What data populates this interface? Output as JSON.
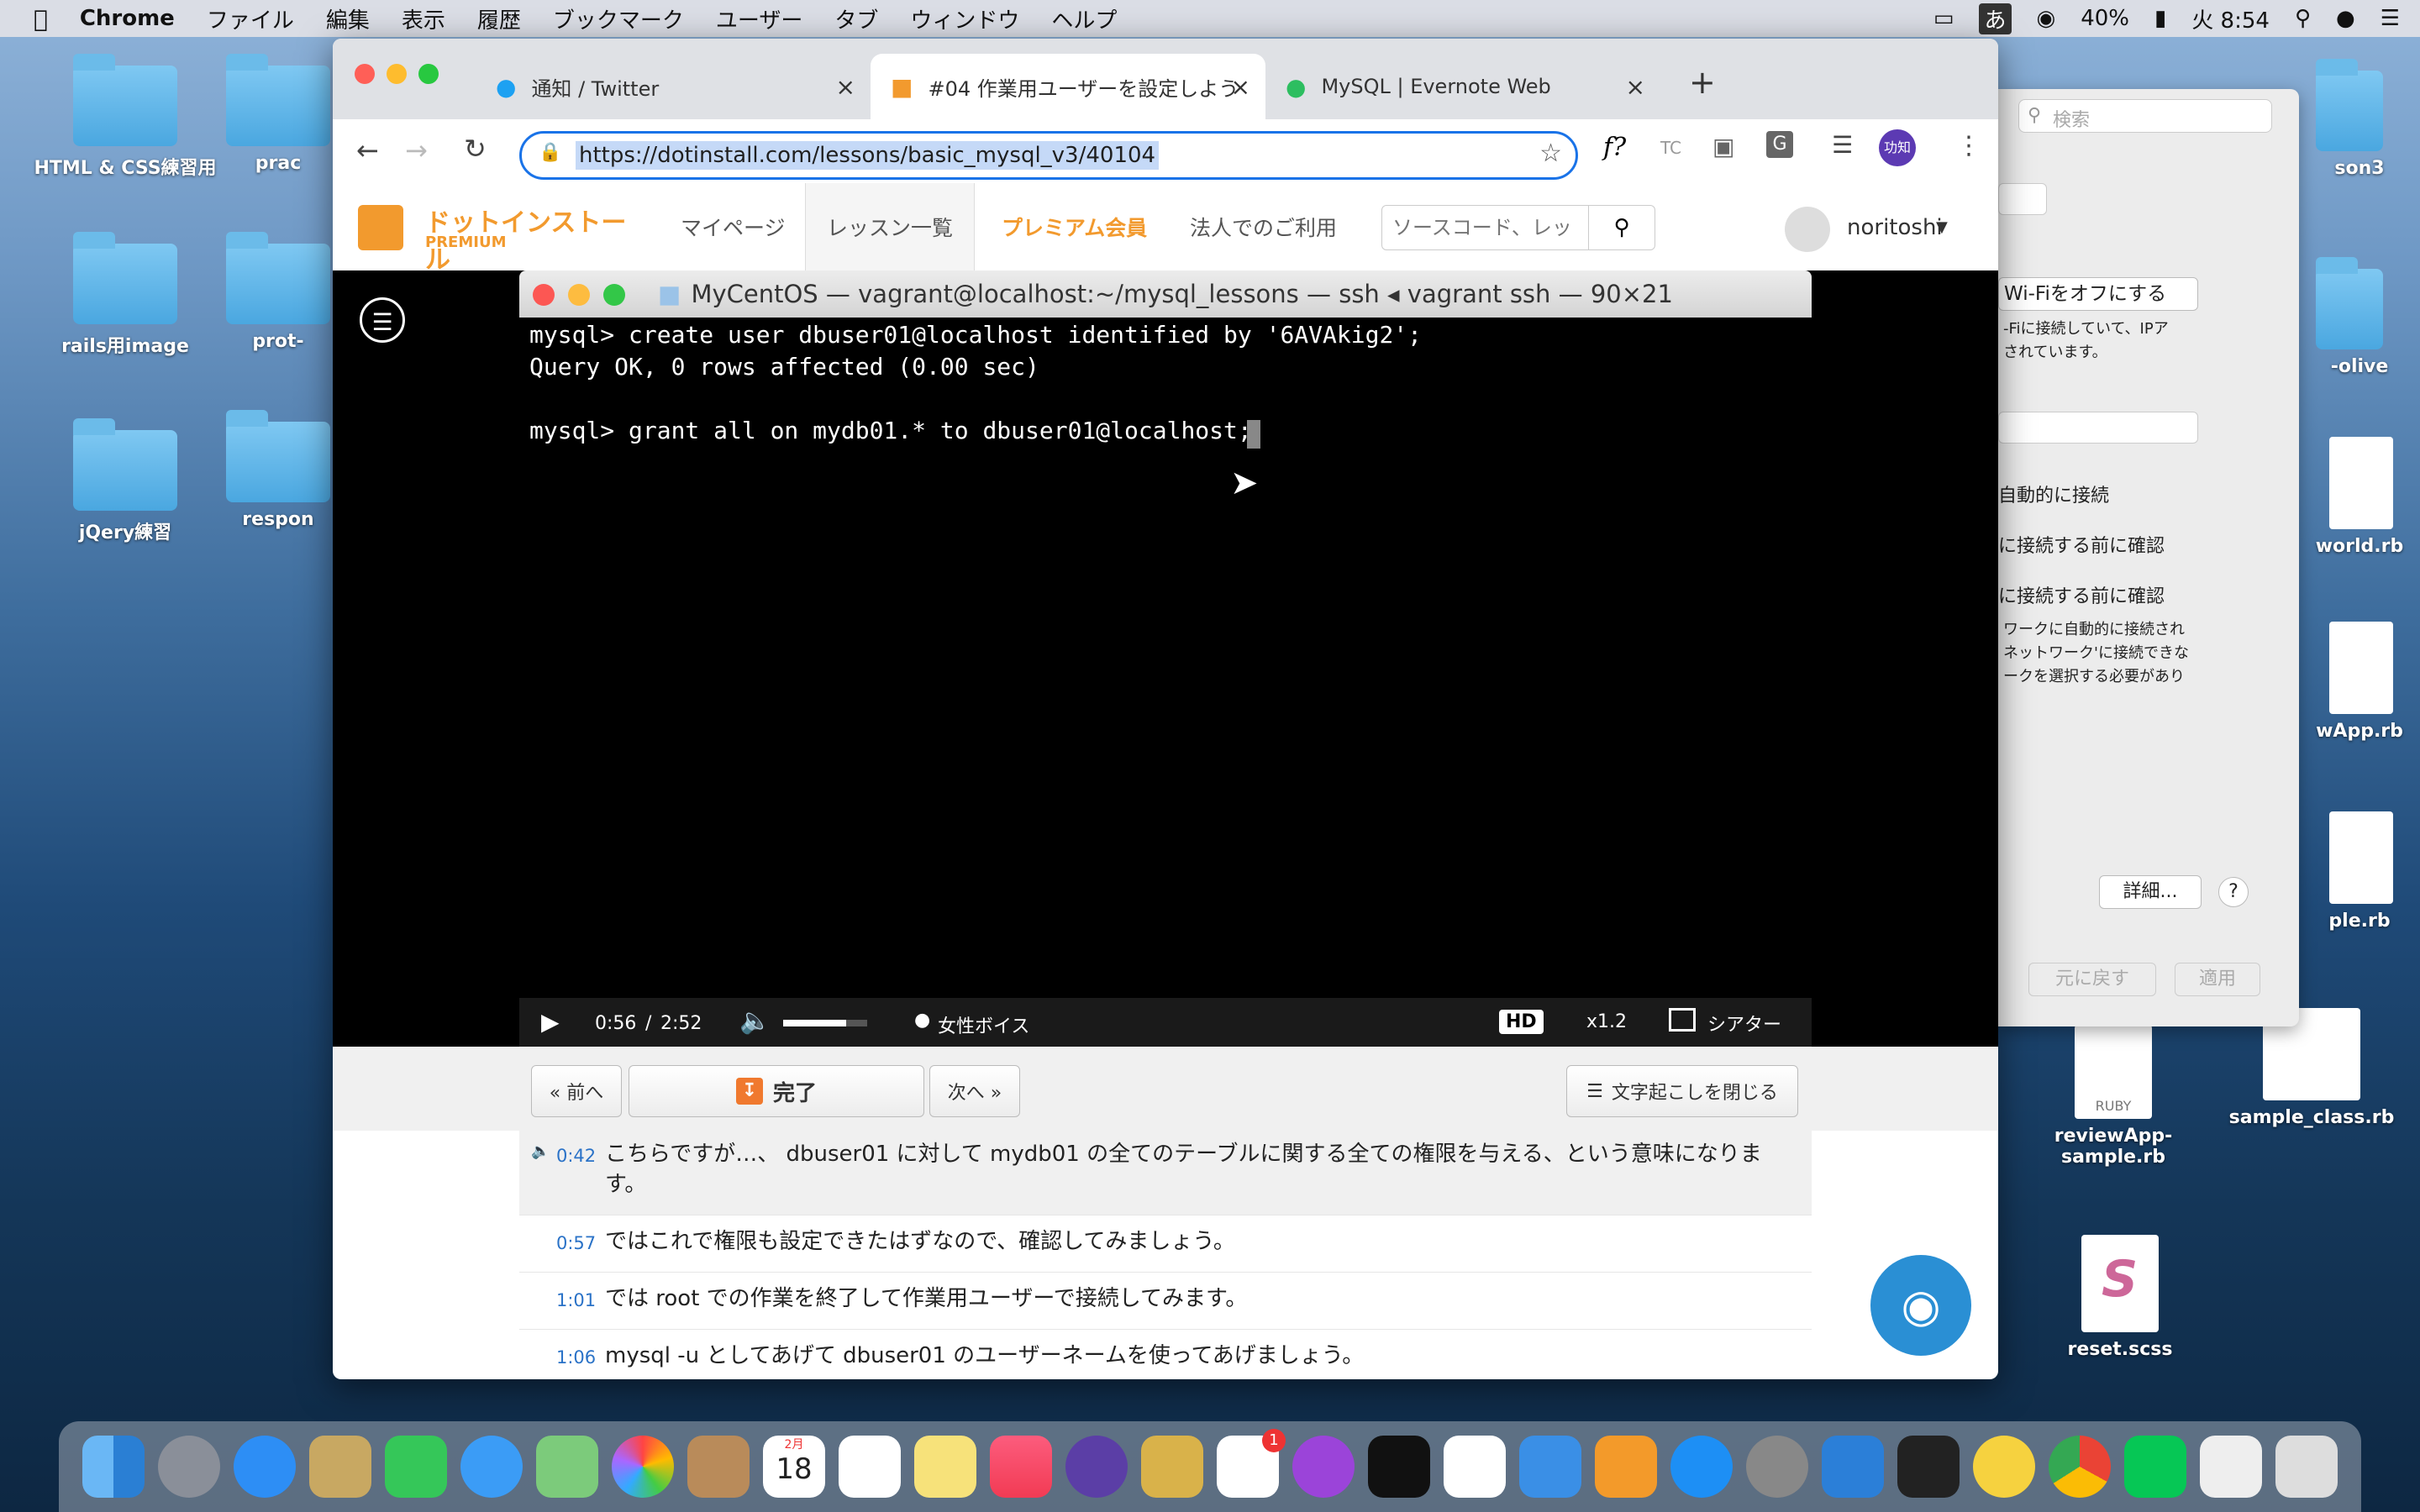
{
  "menubar": {
    "app": "Chrome",
    "items": [
      "ファイル",
      "編集",
      "表示",
      "履歴",
      "ブックマーク",
      "ユーザー",
      "タブ",
      "ウィンドウ",
      "ヘルプ"
    ],
    "ime": "あ",
    "battery": "40%",
    "clock": "火 8:54"
  },
  "desktop": {
    "left_icons": [
      "HTML & CSS練習用",
      "prac",
      "rails用image",
      "prot-",
      "jQery練習",
      "respon"
    ],
    "right_icons": [
      "son3",
      "-olive",
      "world.rb",
      "wApp.rb",
      "ple.rb",
      "reviewApp-sample.rb",
      "sample_class.rb",
      "reset.scss"
    ],
    "ruby_badge": "RUBY"
  },
  "browser": {
    "tabs": [
      {
        "label": "通知 / Twitter"
      },
      {
        "label": "#04 作業用ユーザーを設定しよう"
      },
      {
        "label": "MySQL | Evernote Web"
      }
    ],
    "url": "https://dotinstall.com/lessons/basic_mysql_v3/40104",
    "ext_labels": {
      "fq": "f?",
      "tc": "TC",
      "g": "G",
      "profile": "功知"
    }
  },
  "site": {
    "logo_main": "ドットインストール",
    "logo_sub": "PREMIUM",
    "nav": [
      "マイページ",
      "レッスン一覧",
      "プレミアム会員",
      "法人でのご利用"
    ],
    "search_placeholder": "ソースコード、レッ",
    "user": "noritoshi"
  },
  "terminal": {
    "title": "MyCentOS — vagrant@localhost:~/mysql_lessons — ssh ◂ vagrant ssh — 90×21",
    "lines": [
      "mysql> create user dbuser01@localhost identified by '6AVAkig2';",
      "Query OK, 0 rows affected (0.00 sec)",
      "",
      "mysql> grant all on mydb01.* to dbuser01@localhost;"
    ]
  },
  "player": {
    "current": "0:56",
    "sep": "/",
    "duration": "2:52",
    "volume_level": 0.75,
    "voice": "女性ボイス",
    "hd": "HD",
    "speed": "x1.2",
    "theater": "シアター"
  },
  "lesson_nav": {
    "prev": "« 前へ",
    "done": "完了",
    "next": "次へ »",
    "close_transcript": "文字起こしを閉じる"
  },
  "transcript": [
    {
      "time": "0:42",
      "text": "こちらですが…、 dbuser01 に対して mydb01 の全てのテーブルに関する全ての権限を与える、という意味になります。"
    },
    {
      "time": "0:57",
      "text": "ではこれで権限も設定できたはずなので、確認してみましょう。"
    },
    {
      "time": "1:01",
      "text": "では root での作業を終了して作業用ユーザーで接続してみます。"
    },
    {
      "time": "1:06",
      "text": "mysql -u としてあげて dbuser01 のユーザーネームを使ってあげましょう。"
    }
  ],
  "prefs": {
    "search_placeholder": "検索",
    "wifi_off": "Wi-Fiをオフにする",
    "info": "-Fiに接続していて、IPア されています。",
    "auto_join": "自動的に接続",
    "ask1": "に接続する前に確認",
    "ask2": "に接続する前に確認",
    "desc": "ワークに自動的に接続され ネットワーク'に接続できな ークを選択する必要があり",
    "details": "詳細...",
    "help": "?",
    "revert": "元に戻す",
    "apply": "適用"
  },
  "dock": {
    "calendar_month": "2月",
    "calendar_day": "18",
    "slack_badge": "1"
  }
}
